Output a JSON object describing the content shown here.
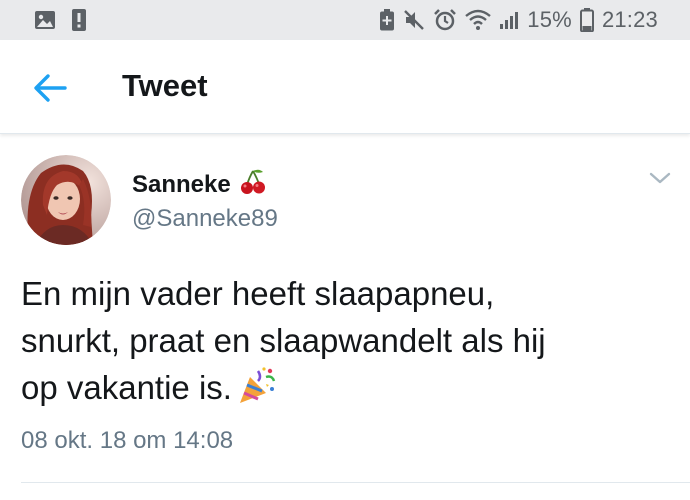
{
  "status_bar": {
    "battery_percent": "15%",
    "time": "21:23",
    "icons": [
      "image-icon",
      "alert-icon",
      "battery-saver-icon",
      "mute-icon",
      "alarm-icon",
      "wifi-icon",
      "signal-icon",
      "battery-icon"
    ]
  },
  "header": {
    "title": "Tweet",
    "back_icon": "arrow-left-icon",
    "accent_color": "#1da1f2"
  },
  "tweet": {
    "user_name": "Sanneke",
    "name_emoji": "cherries-icon",
    "handle": "@Sanneke89",
    "text_lines": [
      "En mijn vader heeft slaapapneu,",
      "snurkt, praat en slaapwandelt als hij",
      "op vakantie is."
    ],
    "text_emoji": "party-popper-icon",
    "timestamp": "08 okt. 18 om 14:08",
    "menu_icon": "chevron-down-icon"
  }
}
